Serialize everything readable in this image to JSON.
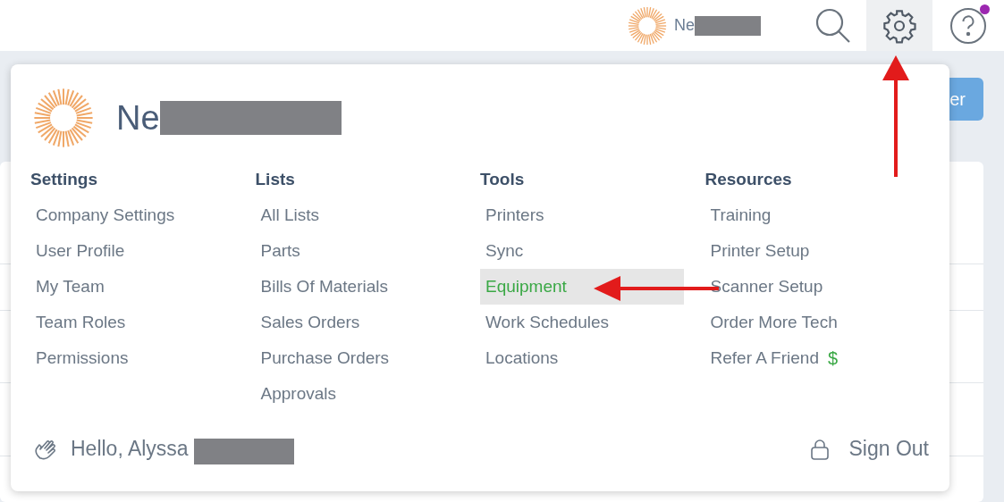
{
  "top_bar": {
    "account_name": "Ne",
    "redacted": true,
    "notification_dot": true,
    "settings_active": true
  },
  "background": {
    "button_label": "er"
  },
  "menu": {
    "account_name": "Ne",
    "redacted": true,
    "columns": [
      {
        "heading": "Settings",
        "items": [
          {
            "label": "Company Settings",
            "selected": false
          },
          {
            "label": "User Profile",
            "selected": false
          },
          {
            "label": "My Team",
            "selected": false
          },
          {
            "label": "Team Roles",
            "selected": false
          },
          {
            "label": "Permissions",
            "selected": false
          }
        ]
      },
      {
        "heading": "Lists",
        "items": [
          {
            "label": "All Lists",
            "selected": false
          },
          {
            "label": "Parts",
            "selected": false
          },
          {
            "label": "Bills Of Materials",
            "selected": false
          },
          {
            "label": "Sales Orders",
            "selected": false
          },
          {
            "label": "Purchase Orders",
            "selected": false
          },
          {
            "label": "Approvals",
            "selected": false
          }
        ]
      },
      {
        "heading": "Tools",
        "items": [
          {
            "label": "Printers",
            "selected": false
          },
          {
            "label": "Sync",
            "selected": false
          },
          {
            "label": "Equipment",
            "selected": true
          },
          {
            "label": "Work Schedules",
            "selected": false
          },
          {
            "label": "Locations",
            "selected": false
          }
        ]
      },
      {
        "heading": "Resources",
        "items": [
          {
            "label": "Training",
            "selected": false
          },
          {
            "label": "Printer Setup",
            "selected": false
          },
          {
            "label": "Scanner Setup",
            "selected": false
          },
          {
            "label": "Order More Tech",
            "selected": false
          },
          {
            "label": "Refer A Friend",
            "selected": false,
            "badge": "$"
          }
        ]
      }
    ],
    "greeting": "Hello, Alyssa",
    "greeting_redacted": true,
    "sign_out": "Sign Out"
  }
}
